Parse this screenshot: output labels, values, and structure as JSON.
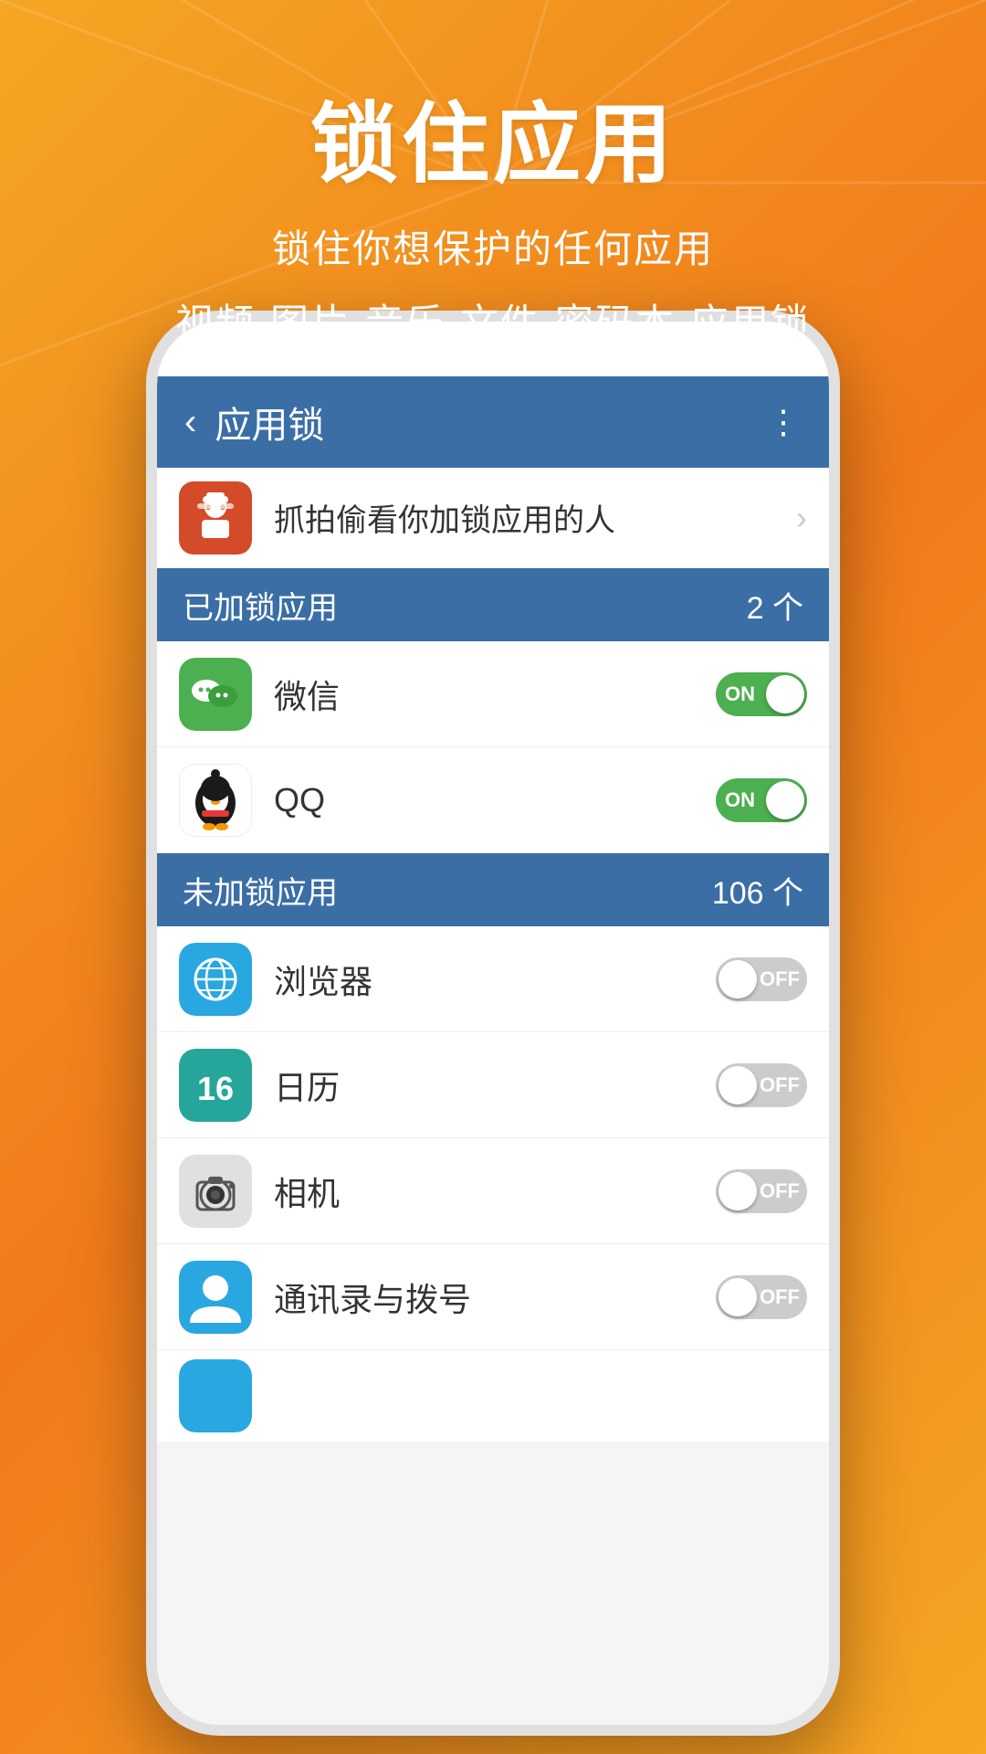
{
  "background": {
    "color": "#F5A623"
  },
  "header": {
    "main_title": "锁住应用",
    "sub_title_1": "锁住你想保护的任何应用",
    "sub_title_2": "视频·图片·音乐·文件·密码本·应用锁"
  },
  "app_bar": {
    "back_label": "‹",
    "title": "应用锁",
    "more_icon": "⋮"
  },
  "spy_row": {
    "label": "抓拍偷看你加锁应用的人",
    "chevron": "›"
  },
  "locked_section": {
    "title": "已加锁应用",
    "count": "2 个"
  },
  "unlocked_section": {
    "title": "未加锁应用",
    "count": "106 个"
  },
  "apps": {
    "locked": [
      {
        "name": "微信",
        "toggle_state": "ON",
        "is_on": true
      },
      {
        "name": "QQ",
        "toggle_state": "ON",
        "is_on": true
      }
    ],
    "unlocked": [
      {
        "name": "浏览器",
        "toggle_state": "OFF",
        "is_on": false
      },
      {
        "name": "日历",
        "toggle_state": "OFF",
        "is_on": false,
        "calendar_number": "16"
      },
      {
        "name": "相机",
        "toggle_state": "OFF",
        "is_on": false
      },
      {
        "name": "通讯录与拨号",
        "toggle_state": "OFF",
        "is_on": false
      }
    ]
  },
  "toggle_labels": {
    "on": "ON",
    "off": "OFF"
  }
}
